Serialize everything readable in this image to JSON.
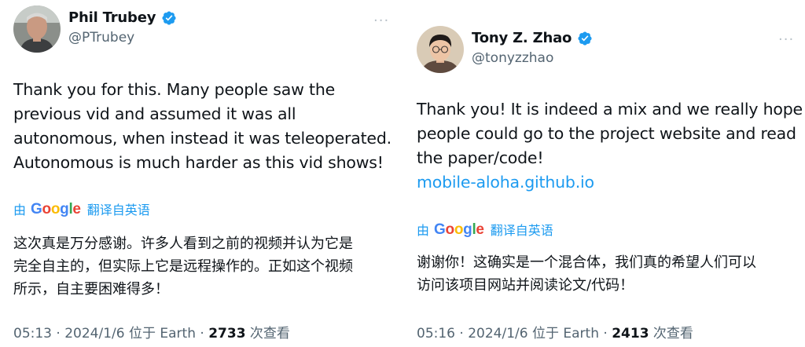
{
  "colors": {
    "accent": "#1d9bf0",
    "text": "#0f1419",
    "muted": "#536471",
    "divider": "#eff3f4"
  },
  "tweets": [
    {
      "display_name": "Phil Trubey",
      "handle": "@PTrubey",
      "verified_icon": "verified-badge-icon",
      "more_icon": "more-options-icon",
      "more_label": "···",
      "body_lines": [
        "Thank you for this. Many people saw the",
        "previous vid and assumed it was all",
        "autonomous, when instead it was teleoperated.",
        "Autonomous is much harder as this vid shows!"
      ],
      "translate": {
        "by": "由",
        "brand": "Google",
        "action": "翻译自英语"
      },
      "translation_lines": [
        "这次真是万分感谢。许多人看到之前的视频并认为它是",
        "完全自主的，但实际上它是远程操作的。正如这个视频",
        "所示，自主要困难得多！"
      ],
      "meta": {
        "time": "05:13",
        "sep1": " · ",
        "date": "2024/1/6",
        "location": " 位于 Earth",
        "sep2": " · ",
        "views": "2733",
        "views_label": " 次查看"
      }
    },
    {
      "display_name": "Tony Z. Zhao",
      "handle": "@tonyzzhao",
      "verified_icon": "verified-badge-icon",
      "more_icon": "more-options-icon",
      "more_label": "···",
      "body_lines": [
        "Thank you! It is indeed a mix and we really hope",
        "people could go to the project website and read",
        "the paper/code!"
      ],
      "link": "mobile-aloha.github.io",
      "translate": {
        "by": "由",
        "brand": "Google",
        "action": "翻译自英语"
      },
      "translation_lines": [
        "谢谢你！这确实是一个混合体，我们真的希望人们可以",
        "访问该项目网站并阅读论文/代码！"
      ],
      "meta": {
        "time": "05:16",
        "sep1": " · ",
        "date": "2024/1/6",
        "location": " 位于 Earth",
        "sep2": " · ",
        "views": "2413",
        "views_label": " 次查看"
      }
    }
  ]
}
